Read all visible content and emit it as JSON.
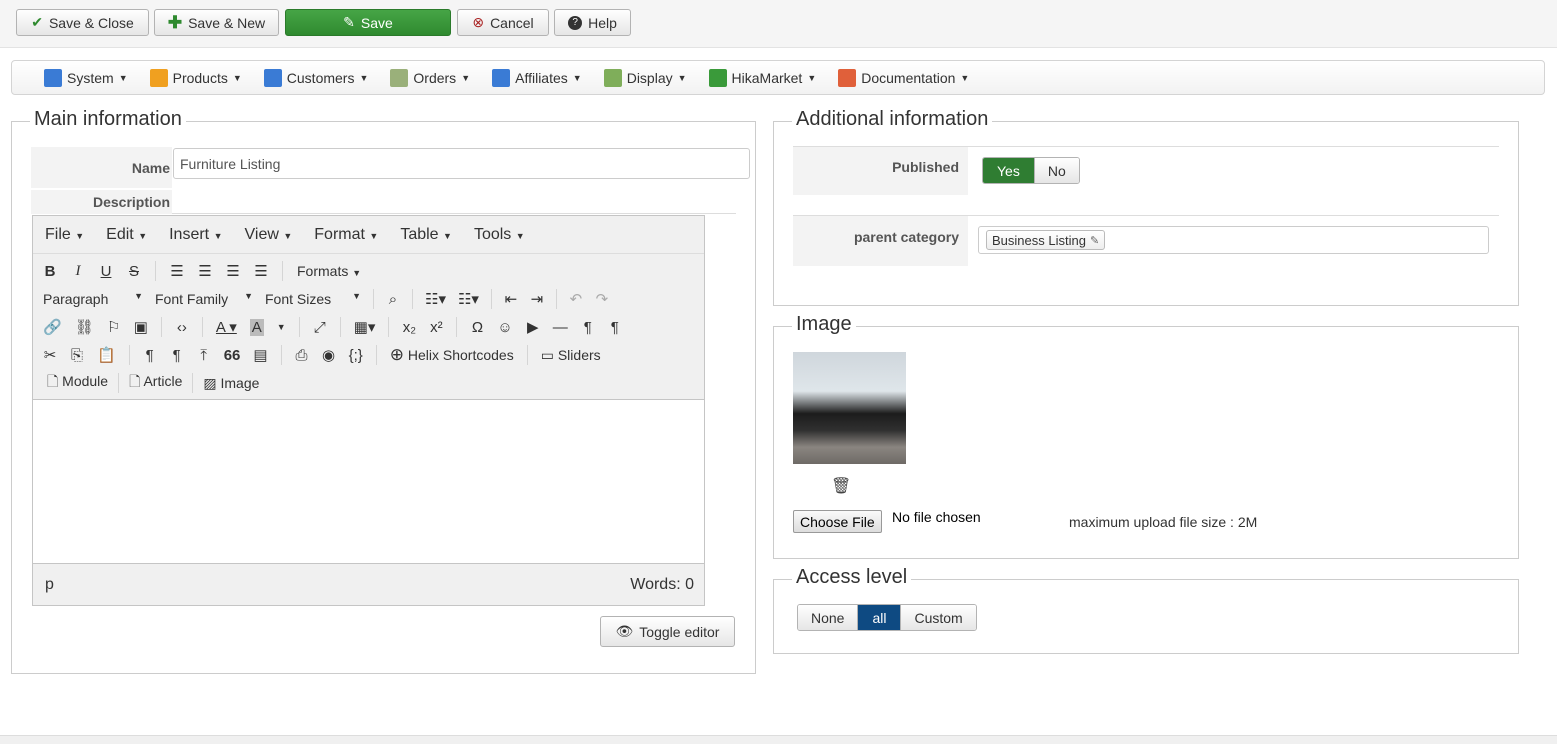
{
  "toolbar": {
    "save_close": "Save & Close",
    "save_new": "Save & New",
    "save": "Save",
    "cancel": "Cancel",
    "help": "Help"
  },
  "menu": [
    {
      "label": "System",
      "icon": "tools-icon",
      "color": "#3a7bd5"
    },
    {
      "label": "Products",
      "icon": "box-icon",
      "color": "#f0a020"
    },
    {
      "label": "Customers",
      "icon": "users-icon",
      "color": "#3a7bd5"
    },
    {
      "label": "Orders",
      "icon": "orders-icon",
      "color": "#9ab07a"
    },
    {
      "label": "Affiliates",
      "icon": "affiliates-icon",
      "color": "#3a7bd5"
    },
    {
      "label": "Display",
      "icon": "display-icon",
      "color": "#7fae5a"
    },
    {
      "label": "HikaMarket",
      "icon": "hikamarket-icon",
      "color": "#3a9a3a"
    },
    {
      "label": "Documentation",
      "icon": "lifebuoy-icon",
      "color": "#e0603a"
    }
  ],
  "main": {
    "title": "Main information",
    "name_label": "Name",
    "name_value": "Furniture Listing",
    "description_label": "Description",
    "editor": {
      "menus": [
        "File",
        "Edit",
        "Insert",
        "View",
        "Format",
        "Table",
        "Tools"
      ],
      "formats": "Formats",
      "paragraph": "Paragraph",
      "font_family": "Font Family",
      "font_sizes": "Font Sizes",
      "helix": "Helix Shortcodes",
      "sliders": "Sliders",
      "module": "Module",
      "article": "Article",
      "image": "Image",
      "path": "p",
      "words": "Words: 0"
    },
    "toggle_editor": "Toggle editor"
  },
  "additional": {
    "title": "Additional information",
    "published_label": "Published",
    "yes": "Yes",
    "no": "No",
    "parent_label": "parent category",
    "parent_tag": "Business Listing"
  },
  "image": {
    "title": "Image",
    "choose_file": "Choose File",
    "no_file": "No file chosen",
    "max_size": "maximum upload file size : 2M"
  },
  "access": {
    "title": "Access level",
    "options": [
      "None",
      "all",
      "Custom"
    ],
    "selected": "all"
  }
}
